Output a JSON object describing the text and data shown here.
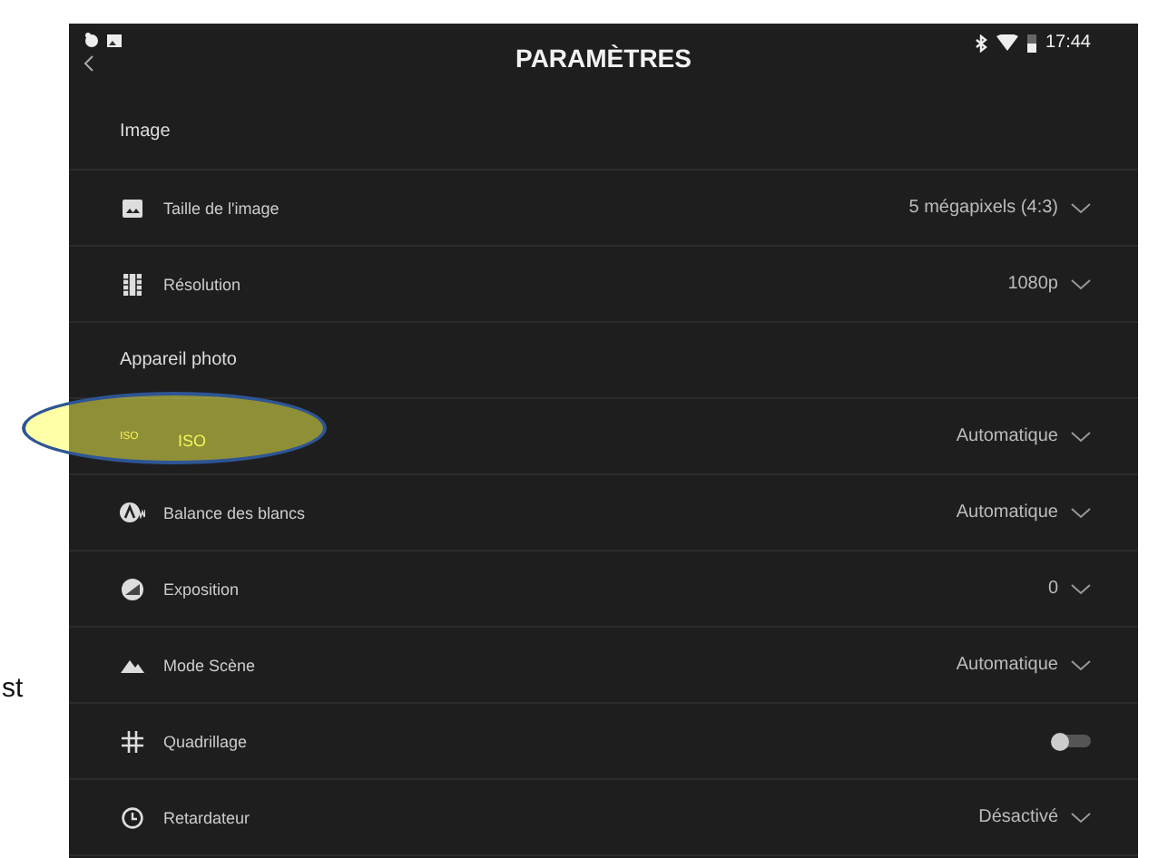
{
  "side_text": "st",
  "status_bar": {
    "time": "17:44"
  },
  "header": {
    "title": "PARAMÈTRES"
  },
  "sections": [
    {
      "title": "Image",
      "items": [
        {
          "label": "Taille de l'image",
          "kind": "select",
          "value": "5 mégapixels (4:3)",
          "highlighted": false
        },
        {
          "label": "Résolution",
          "kind": "select",
          "value": "1080p",
          "highlighted": false
        }
      ]
    },
    {
      "title": "Appareil photo",
      "items": [
        {
          "icon_label": "ISO",
          "label": "ISO",
          "kind": "select",
          "value": "Automatique",
          "highlighted": true
        },
        {
          "label": "Balance des blancs",
          "kind": "select",
          "value": "Automatique",
          "highlighted": false
        },
        {
          "label": "Exposition",
          "kind": "select",
          "value": "0",
          "highlighted": false
        },
        {
          "label": "Mode Scène",
          "kind": "select",
          "value": "Automatique",
          "highlighted": false
        },
        {
          "label": "Quadrillage",
          "kind": "toggle",
          "on": false,
          "highlighted": false
        },
        {
          "label": "Retardateur",
          "kind": "select",
          "value": "Désactivé",
          "highlighted": false
        }
      ]
    }
  ]
}
